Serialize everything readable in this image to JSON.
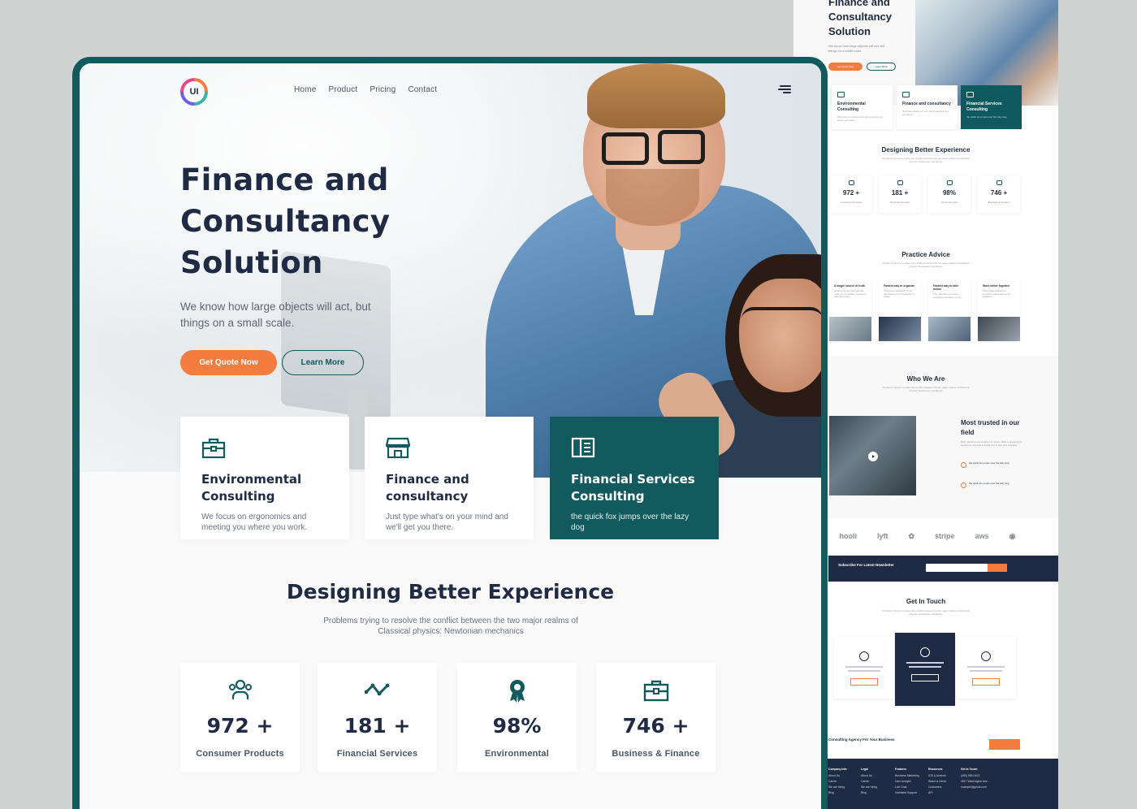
{
  "brand": {
    "logo_text": "UI"
  },
  "nav": {
    "items": [
      "Home",
      "Product",
      "Pricing",
      "Contact"
    ]
  },
  "hero": {
    "title_lines": [
      "Finance and",
      "Consultancy",
      "Solution"
    ],
    "subtitle": "We know how large objects will act, but things on a small scale.",
    "primary_button": "Get Quote Now",
    "secondary_button": "Learn More"
  },
  "services": [
    {
      "title": "Environmental Consulting",
      "desc": "We focus on ergonomics and meeting you where you work.",
      "icon": "briefcase-icon",
      "active": false
    },
    {
      "title": "Finance and consultancy",
      "desc": "Just type what's on your mind and we'll get you there.",
      "icon": "store-icon",
      "active": false
    },
    {
      "title": "Financial Services Consulting",
      "desc": "the quick fox jumps over the lazy dog",
      "icon": "book-open-icon",
      "active": true
    }
  ],
  "experience": {
    "title": "Designing Better Experience",
    "subtitle": "Problems trying to resolve the conflict between the two major realms of Classical physics: Newtonian mechanics",
    "stats": [
      {
        "value": "972 +",
        "label": "Consumer Products",
        "icon": "users-icon"
      },
      {
        "value": "181 +",
        "label": "Financial Services",
        "icon": "trend-icon"
      },
      {
        "value": "98%",
        "label": "Environmental",
        "icon": "award-icon"
      },
      {
        "value": "746 +",
        "label": "Business & Finance",
        "icon": "briefcase-icon"
      }
    ]
  },
  "preview": {
    "hero_title": "Finance and Consultancy Solution",
    "hero_sub": "We know how large objects will act, but things on a small scale.",
    "btn1": "Get Quote Now",
    "btn2": "Learn More",
    "cards": [
      {
        "title": "Environmental Consulting",
        "desc": "We focus on ergonomics and meeting you where you work."
      },
      {
        "title": "Finance and consultancy",
        "desc": "Just type what's on your mind and we'll get you there."
      },
      {
        "title": "Financial Services Consulting",
        "desc": "the quick fox jumps over the lazy dog"
      }
    ],
    "section1_title": "Designing Better Experience",
    "section_sub": "Problems trying to resolve the conflict between the two major realms of Classical physics: Newtonian mechanics",
    "stats": [
      {
        "value": "972 +",
        "label": "Consumer Products"
      },
      {
        "value": "181 +",
        "label": "Financial Services"
      },
      {
        "value": "98%",
        "label": "Environmental"
      },
      {
        "value": "746 +",
        "label": "Business & Finance"
      }
    ],
    "section2_title": "Practice Advice",
    "advice": [
      {
        "title": "A single source of truth",
        "desc": "Newton thought that light was made up of particles, but then it was discovered"
      },
      {
        "title": "Fastest way to organize",
        "desc": "\"Quantum mechanics\" is the description of the behaviour of matter"
      },
      {
        "title": "Fastest way to take action",
        "desc": "They describe a universe consisting of bodies moving"
      },
      {
        "title": "Work better together",
        "desc": "They finally reflected a consistent description of the behaviour"
      }
    ],
    "section3_title": "Who We Are",
    "trust_title": "Most trusted in our field",
    "trust_desc": "Most calendars are designed for teams. Slate is designed for freelancers and with a simple way to plan their schedule.",
    "bullets": [
      "the quick fox jumps over the lazy dog",
      "the quick fox jumps over the lazy dog"
    ],
    "logos": [
      "hooli",
      "lyft",
      "",
      "stripe",
      "aws",
      ""
    ],
    "newsletter": "Subscribe For Latest Newsletter",
    "section4_title": "Get In Touch",
    "cta_text": "Consulting Agency For Your Business",
    "footer_cols": [
      {
        "title": "Company Info",
        "items": [
          "About Us",
          "Carrier",
          "We are hiring",
          "Blog"
        ]
      },
      {
        "title": "Legal",
        "items": [
          "About Us",
          "Carrier",
          "We are hiring",
          "Blog"
        ]
      },
      {
        "title": "Features",
        "items": [
          "Business Marketing",
          "User Analytic",
          "Live Chat",
          "Unlimited Support"
        ]
      },
      {
        "title": "Resources",
        "items": [
          "IOS & Android",
          "Watch a Demo",
          "Customers",
          "API"
        ]
      },
      {
        "title": "Get In Touch",
        "items": [
          "(480) 555-0103",
          "4517 Washington Ave.",
          "example@gmail.com"
        ]
      }
    ]
  },
  "colors": {
    "primary": "#125a5e",
    "accent": "#f57c3f",
    "heading": "#1f2a44",
    "background": "#cfd3d1"
  }
}
